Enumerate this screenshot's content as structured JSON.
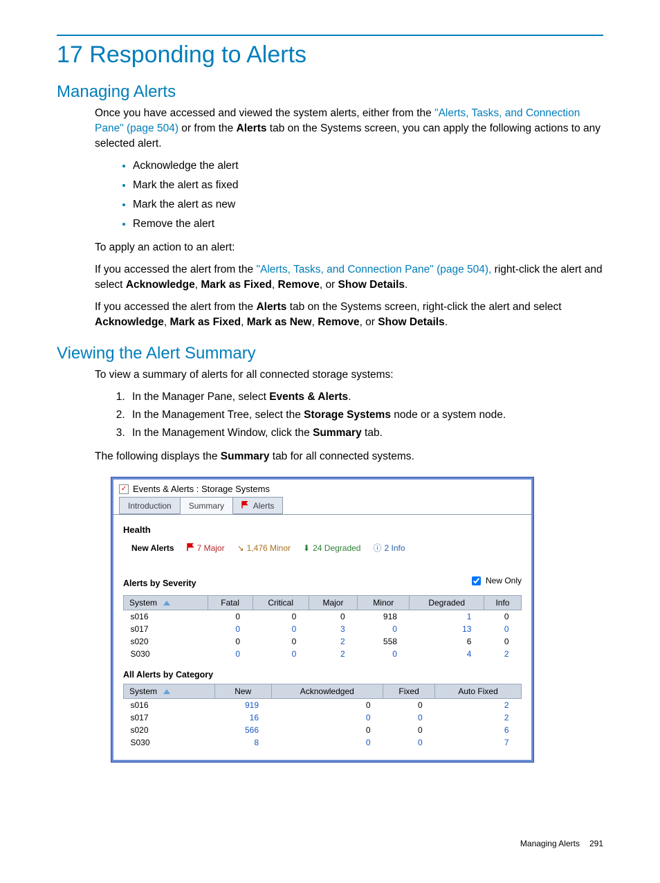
{
  "chapter_title": "17 Responding to Alerts",
  "section_managing_title": "Managing Alerts",
  "managing": {
    "intro_pre": "Once you have accessed and viewed the system alerts, either from the ",
    "intro_link1": "\"Alerts, Tasks, and Connection Pane\" (page 504)",
    "intro_mid": " or from the ",
    "intro_bold1": "Alerts",
    "intro_post": " tab on the Systems screen, you can apply the following actions to any selected alert.",
    "bullets": [
      "Acknowledge the alert",
      "Mark the alert as fixed",
      "Mark the alert as new",
      "Remove the alert"
    ],
    "apply_line": "To apply an action to an alert:",
    "p2_pre": "If you accessed the alert from the ",
    "p2_link": "\"Alerts, Tasks, and Connection Pane\" (page 504),",
    "p2_mid": " right-click the alert and select ",
    "p2_b1": "Acknowledge",
    "p2_s1": ", ",
    "p2_b2": "Mark as Fixed",
    "p2_s2": ", ",
    "p2_b3": "Remove",
    "p2_s3": ", or ",
    "p2_b4": "Show Details",
    "p2_end": ".",
    "p3_pre": "If you accessed the alert from the ",
    "p3_b0": "Alerts",
    "p3_mid": " tab on the Systems screen, right-click the alert and select ",
    "p3_b1": "Acknowledge",
    "p3_s1": ", ",
    "p3_b2": "Mark as Fixed",
    "p3_s2": ", ",
    "p3_b3": "Mark as New",
    "p3_s3": ", ",
    "p3_b4": "Remove",
    "p3_s4": ", or ",
    "p3_b5": "Show Details",
    "p3_end": "."
  },
  "section_viewing_title": "Viewing the Alert Summary",
  "viewing": {
    "intro": "To view a summary of alerts for all connected storage systems:",
    "step1_pre": "In the Manager Pane, select ",
    "step1_b": "Events & Alerts",
    "step1_end": ".",
    "step2_pre": "In the Management Tree, select the ",
    "step2_b": "Storage Systems",
    "step2_end": " node or a system node.",
    "step3_pre": "In the Management Window, click the ",
    "step3_b": "Summary",
    "step3_end": " tab.",
    "p_after_pre": "The following displays the ",
    "p_after_b": "Summary",
    "p_after_end": " tab for all connected systems."
  },
  "screenshot": {
    "window_title": "Events & Alerts : Storage Systems",
    "tabs": {
      "introduction": "Introduction",
      "summary": "Summary",
      "alerts": "Alerts"
    },
    "health_hdr": "Health",
    "new_alerts_label": "New Alerts",
    "stats": {
      "major": "7 Major",
      "minor": "1,476 Minor",
      "degraded": "24 Degraded",
      "info": "2 Info"
    },
    "severity_hdr": "Alerts by Severity",
    "new_only_label": "New Only",
    "sev_cols": [
      "System",
      "Fatal",
      "Critical",
      "Major",
      "Minor",
      "Degraded",
      "Info"
    ],
    "sev_rows": [
      {
        "sys": "s016",
        "fatal": "0",
        "crit": "0",
        "maj": "0",
        "min": "918",
        "deg": "1",
        "info": "0",
        "hl": [
          "deg"
        ]
      },
      {
        "sys": "s017",
        "fatal": "0",
        "crit": "0",
        "maj": "3",
        "min": "0",
        "deg": "13",
        "info": "0",
        "hl": [
          "fatal",
          "crit",
          "maj",
          "min",
          "deg",
          "info"
        ]
      },
      {
        "sys": "s020",
        "fatal": "0",
        "crit": "0",
        "maj": "2",
        "min": "558",
        "deg": "6",
        "info": "0",
        "hl": [
          "maj"
        ]
      },
      {
        "sys": "S030",
        "fatal": "0",
        "crit": "0",
        "maj": "2",
        "min": "0",
        "deg": "4",
        "info": "2",
        "hl": [
          "fatal",
          "crit",
          "maj",
          "min",
          "deg",
          "info"
        ]
      }
    ],
    "cat_hdr": "All Alerts by Category",
    "cat_cols": [
      "System",
      "New",
      "Acknowledged",
      "Fixed",
      "Auto Fixed"
    ],
    "cat_rows": [
      {
        "sys": "s016",
        "new": "919",
        "ack": "0",
        "fix": "0",
        "auto": "2",
        "hl": [
          "new",
          "auto"
        ]
      },
      {
        "sys": "s017",
        "new": "16",
        "ack": "0",
        "fix": "0",
        "auto": "2",
        "hl": [
          "new",
          "ack",
          "fix",
          "auto"
        ]
      },
      {
        "sys": "s020",
        "new": "566",
        "ack": "0",
        "fix": "0",
        "auto": "6",
        "hl": [
          "new",
          "auto"
        ]
      },
      {
        "sys": "S030",
        "new": "8",
        "ack": "0",
        "fix": "0",
        "auto": "7",
        "hl": [
          "new",
          "ack",
          "fix",
          "auto"
        ]
      }
    ]
  },
  "footer": {
    "label": "Managing Alerts",
    "pageno": "291"
  }
}
